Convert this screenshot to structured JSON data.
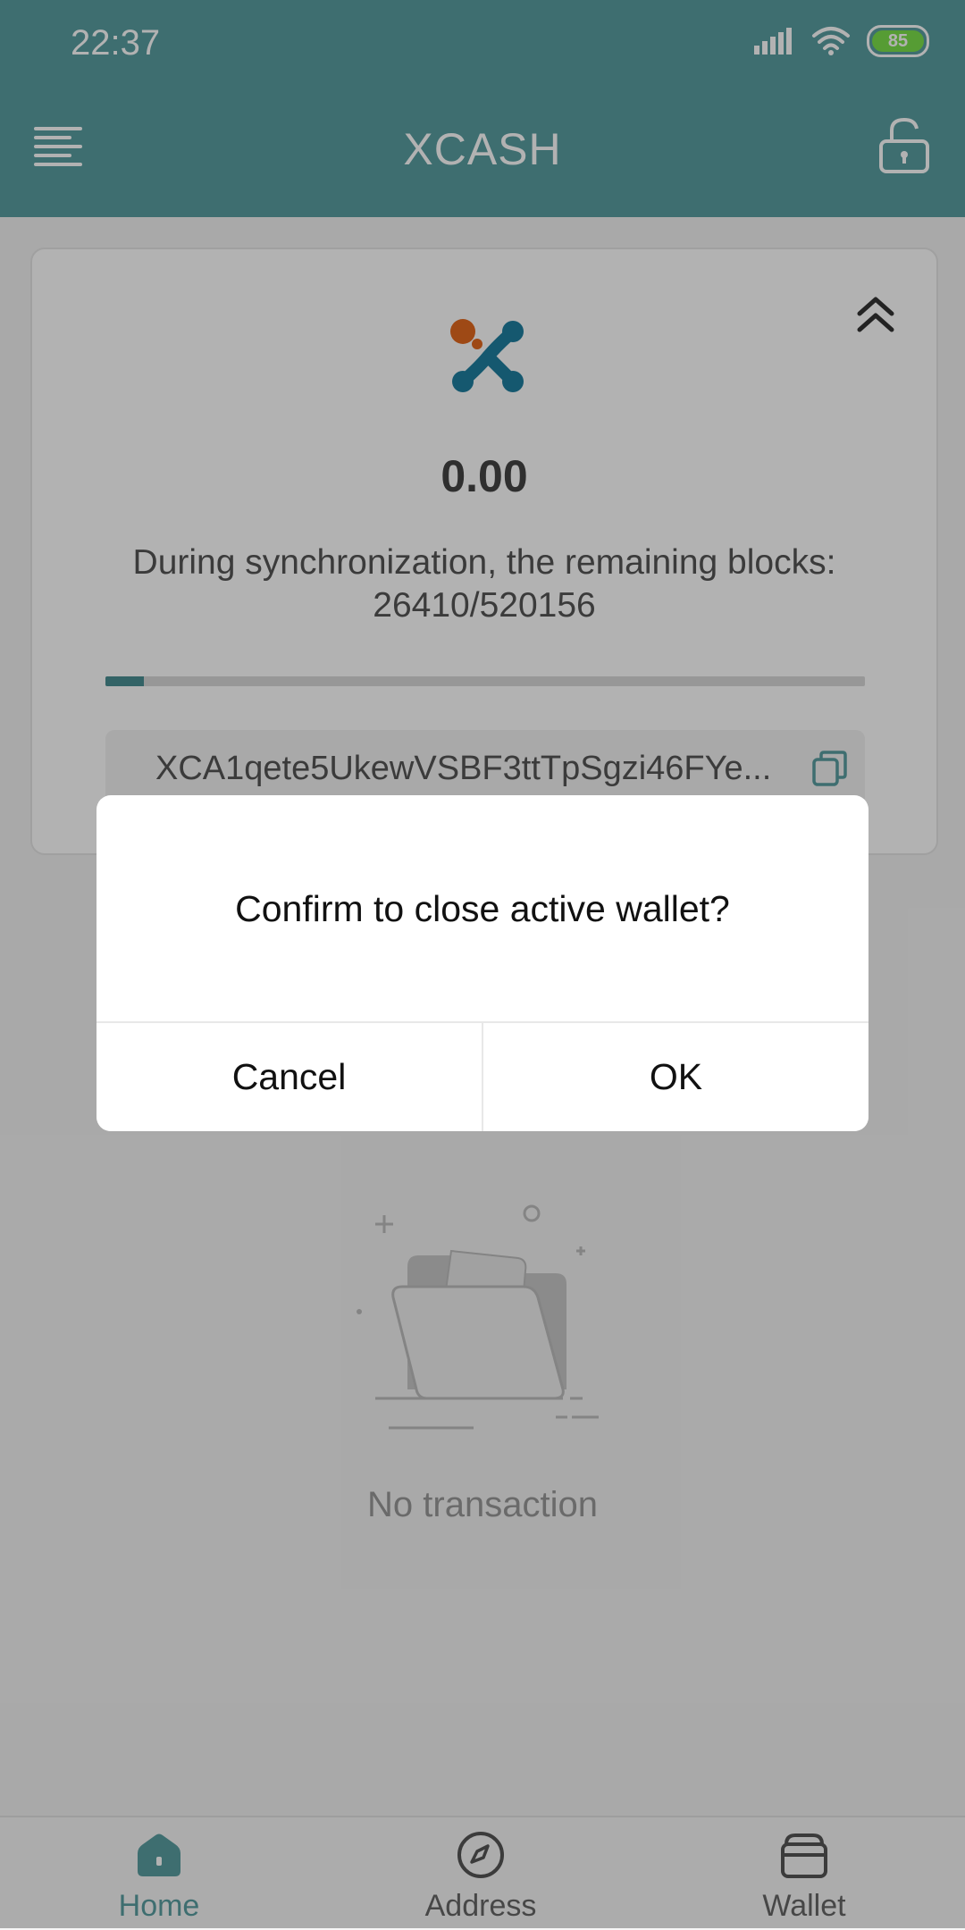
{
  "status_bar": {
    "time": "22:37",
    "battery_level": "85",
    "icons": [
      "signal-icon",
      "wifi-icon",
      "battery-icon"
    ]
  },
  "app_bar": {
    "title": "XCASH",
    "menu_icon": "menu-icon",
    "lock_icon": "unlock-icon"
  },
  "wallet_card": {
    "balance": "0.00",
    "sync_text": "During synchronization, the remaining blocks: 26410/520156",
    "sync_progress": 0.0508,
    "address": "XCA1qete5UkewVSBF3ttTpSgzi46FYe...",
    "collapse_icon": "double-chevron-up-icon",
    "copy_icon": "copy-icon"
  },
  "empty_state": {
    "message": "No transaction",
    "icon": "empty-folder-illustration"
  },
  "bottom_nav": {
    "items": [
      {
        "label": "Home",
        "icon": "home-icon",
        "active": true
      },
      {
        "label": "Address",
        "icon": "compass-icon",
        "active": false
      },
      {
        "label": "Wallet",
        "icon": "wallet-icon",
        "active": false
      }
    ]
  },
  "dialog": {
    "message": "Confirm to close active wallet?",
    "cancel_label": "Cancel",
    "ok_label": "OK"
  },
  "colors": {
    "primary": "#5a9ea1",
    "logo_orange": "#e2691f",
    "logo_teal": "#1f7f9f",
    "background": "#f3f3f3"
  }
}
